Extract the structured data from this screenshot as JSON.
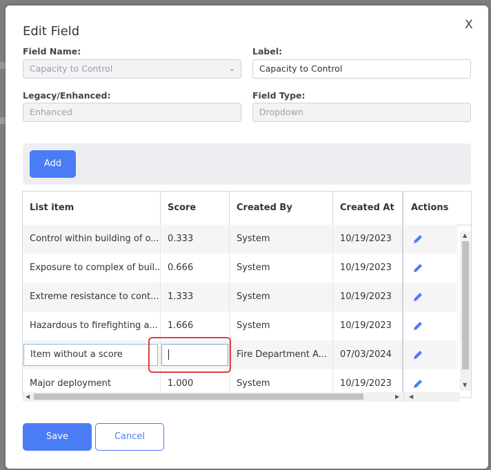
{
  "modal": {
    "title": "Edit Field",
    "close_label": "X"
  },
  "form": {
    "field_name_label": "Field Name:",
    "field_name_value": "Capacity to Control",
    "label_label": "Label:",
    "label_value": "Capacity to Control",
    "legacy_label": "Legacy/Enhanced:",
    "legacy_value": "Enhanced",
    "field_type_label": "Field Type:",
    "field_type_value": "Dropdown"
  },
  "toolbar": {
    "add_label": "Add"
  },
  "table": {
    "headers": [
      "List item",
      "Score",
      "Created By",
      "Created At",
      "Actions"
    ],
    "rows": [
      {
        "item": "Control within building of o...",
        "score": "0.333",
        "created_by": "System",
        "created_at": "10/19/2023"
      },
      {
        "item": "Exposure to complex of buil...",
        "score": "0.666",
        "created_by": "System",
        "created_at": "10/19/2023"
      },
      {
        "item": "Extreme resistance to cont...",
        "score": "1.333",
        "created_by": "System",
        "created_at": "10/19/2023"
      },
      {
        "item": "Hazardous to firefighting a...",
        "score": "1.666",
        "created_by": "System",
        "created_at": "10/19/2023"
      },
      {
        "item": "Item without a score",
        "score": "",
        "created_by": "Fire Department A...",
        "created_at": "07/03/2024"
      },
      {
        "item": "Major deployment",
        "score": "1.000",
        "created_by": "System",
        "created_at": "10/19/2023"
      }
    ]
  },
  "footer": {
    "save_label": "Save",
    "cancel_label": "Cancel"
  },
  "colors": {
    "accent": "#4a7cf5",
    "highlight": "#e03b3b"
  }
}
